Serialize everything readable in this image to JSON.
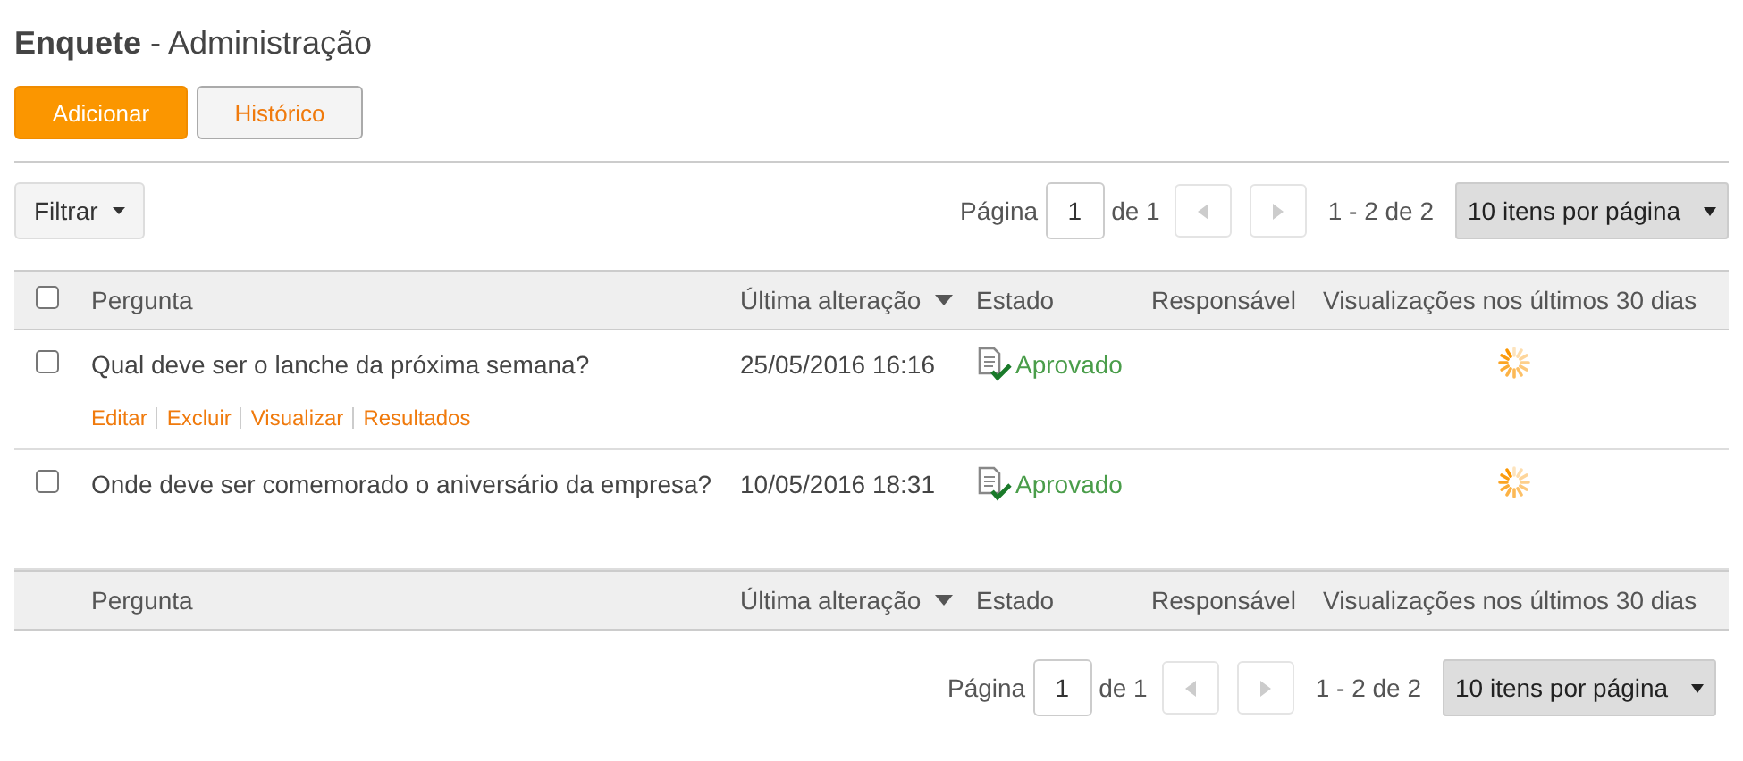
{
  "title": {
    "module": "Enquete",
    "section": " - Administração"
  },
  "toolbar": {
    "buttons": [
      {
        "label": "Adicionar",
        "kind": "primary"
      },
      {
        "label": "Histórico",
        "kind": "default"
      }
    ]
  },
  "filter": {
    "label": "Filtrar"
  },
  "pager_top": {
    "page_label": "Página",
    "page_value": "1",
    "of_label": "de 1",
    "prev_disabled": true,
    "next_disabled": true,
    "range": "1 - 2 de 2",
    "per_page": "10 itens por página"
  },
  "table": {
    "select_all_checked": false,
    "columns": [
      {
        "label": "Pergunta",
        "sorted": false
      },
      {
        "label": "Última alteração",
        "sorted": true
      },
      {
        "label": "Estado",
        "sorted": false
      },
      {
        "label": "Responsável",
        "sorted": false
      },
      {
        "label": "Visualizações nos últimos 30 dias",
        "sorted": false
      }
    ],
    "rows": [
      {
        "checked": false,
        "question": "Qual deve ser o lanche da próxima semana?",
        "modified": "25/05/2016 16:16",
        "status": "Aprovado",
        "actions": [
          "Editar",
          "Excluir",
          "Visualizar",
          "Resultados"
        ]
      },
      {
        "checked": false,
        "question": "Onde deve ser comemorado o aniversário da empresa?",
        "modified": "10/05/2016 18:31",
        "status": "Aprovado"
      }
    ],
    "footer_columns": [
      {
        "label": "Pergunta",
        "sorted": false
      },
      {
        "label": "Última alteração",
        "sorted": true
      },
      {
        "label": "Estado",
        "sorted": false
      },
      {
        "label": "Responsável",
        "sorted": false
      },
      {
        "label": "Visualizações nos últimos 30 dias",
        "sorted": false
      }
    ]
  },
  "pager_bottom": {
    "page_label": "Página",
    "page_value": "1",
    "of_label": "de 1",
    "prev_disabled": true,
    "next_disabled": true,
    "range": "1 - 2 de 2",
    "per_page": "10 itens por página"
  }
}
